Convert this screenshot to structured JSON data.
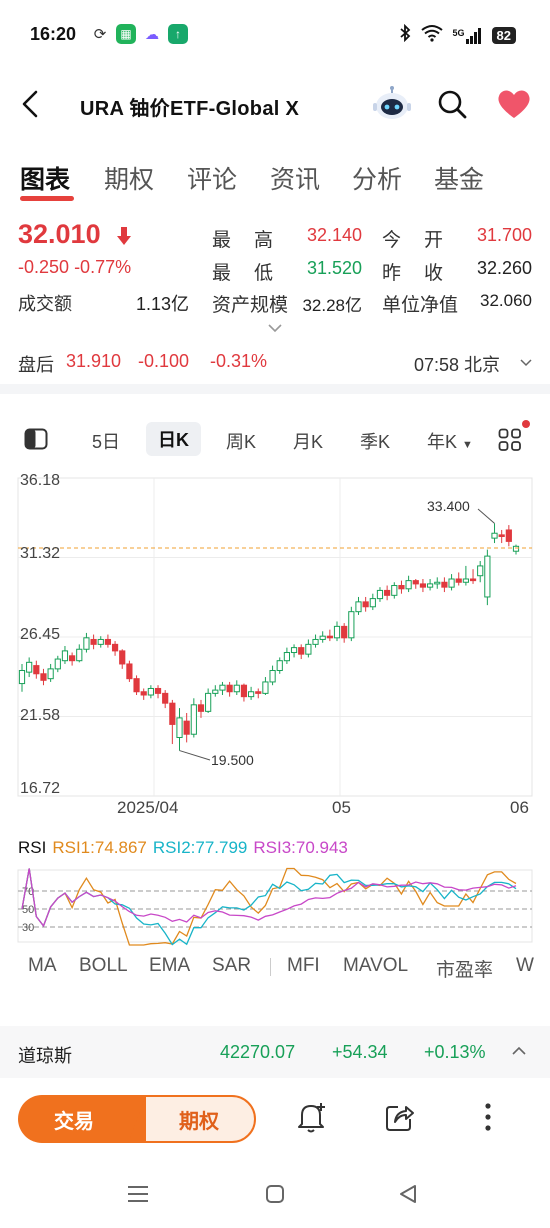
{
  "status": {
    "time": "16:20",
    "signal": "5G",
    "battery": "82"
  },
  "header": {
    "title": "URA  铀价ETF-Global X"
  },
  "tabs": [
    "图表",
    "期权",
    "评论",
    "资讯",
    "分析",
    "基金"
  ],
  "quote": {
    "price": "32.010",
    "change": "-0.250",
    "change_pct": "-0.77%",
    "volume_label": "成交额",
    "volume": "1.13亿",
    "high_label": "最　高",
    "high": "32.140",
    "low_label": "最　低",
    "low": "31.520",
    "aum_label": "资产规模",
    "aum": "32.28亿",
    "open_label": "今　开",
    "open": "31.700",
    "prev_close_label": "昨　收",
    "prev_close": "32.260",
    "nav_label": "单位净值",
    "nav": "32.060"
  },
  "after_hours": {
    "label": "盘后",
    "price": "31.910",
    "change": "-0.100",
    "change_pct": "-0.31%",
    "time": "07:58 北京"
  },
  "periods": [
    "5日",
    "日K",
    "周K",
    "月K",
    "季K",
    "年K"
  ],
  "colors": {
    "up": "#e0393e",
    "down": "#18a058",
    "accent": "#f0711e",
    "rsi1": "#e08a1e",
    "rsi2": "#18b4c8",
    "rsi3": "#c848c8"
  },
  "chart_data": {
    "type": "candlestick",
    "y_ticks": [
      "36.18",
      "31.32",
      "26.45",
      "21.58",
      "16.72"
    ],
    "ylim": [
      16.72,
      36.18
    ],
    "x_ticks": [
      "2025/04",
      "05",
      "06"
    ],
    "high_annotation": "33.400",
    "low_annotation": "19.500",
    "current_price_line": 31.9,
    "candles": [
      [
        23.6,
        24.4,
        24.8,
        23.1
      ],
      [
        24.3,
        24.9,
        25.2,
        24.0
      ],
      [
        24.7,
        24.2,
        25.0,
        23.9
      ],
      [
        24.2,
        23.8,
        24.5,
        23.5
      ],
      [
        23.9,
        24.5,
        24.8,
        23.7
      ],
      [
        24.5,
        25.1,
        25.3,
        24.3
      ],
      [
        25.0,
        25.6,
        25.9,
        24.8
      ],
      [
        25.3,
        25.0,
        25.5,
        24.7
      ],
      [
        25.0,
        25.7,
        26.0,
        24.9
      ],
      [
        25.7,
        26.4,
        26.7,
        25.5
      ],
      [
        26.3,
        26.0,
        26.6,
        25.7
      ],
      [
        26.0,
        26.3,
        26.5,
        25.8
      ],
      [
        26.3,
        26.0,
        26.6,
        25.8
      ],
      [
        26.0,
        25.6,
        26.2,
        25.3
      ],
      [
        25.6,
        24.8,
        25.7,
        24.5
      ],
      [
        24.8,
        23.9,
        25.0,
        23.7
      ],
      [
        23.9,
        23.1,
        24.1,
        22.9
      ],
      [
        23.1,
        22.9,
        23.3,
        22.6
      ],
      [
        22.9,
        23.3,
        23.5,
        22.7
      ],
      [
        23.3,
        23.0,
        23.5,
        22.7
      ],
      [
        23.0,
        22.4,
        23.2,
        22.1
      ],
      [
        22.4,
        21.1,
        22.6,
        19.9
      ],
      [
        20.3,
        21.5,
        22.1,
        19.5
      ],
      [
        21.3,
        20.5,
        21.8,
        20.0
      ],
      [
        20.5,
        22.3,
        22.7,
        20.3
      ],
      [
        22.3,
        21.9,
        22.6,
        21.5
      ],
      [
        21.9,
        23.0,
        23.3,
        21.8
      ],
      [
        23.0,
        23.2,
        23.5,
        22.8
      ],
      [
        23.2,
        23.5,
        23.7,
        22.9
      ],
      [
        23.5,
        23.1,
        23.7,
        22.8
      ],
      [
        23.1,
        23.5,
        23.8,
        22.9
      ],
      [
        23.5,
        22.8,
        23.6,
        22.5
      ],
      [
        22.8,
        23.1,
        23.4,
        22.6
      ],
      [
        23.1,
        23.0,
        23.3,
        22.7
      ],
      [
        23.0,
        23.7,
        24.0,
        22.9
      ],
      [
        23.7,
        24.4,
        24.7,
        23.5
      ],
      [
        24.4,
        25.0,
        25.2,
        24.2
      ],
      [
        25.0,
        25.5,
        25.8,
        24.8
      ],
      [
        25.5,
        25.8,
        26.0,
        25.2
      ],
      [
        25.8,
        25.4,
        26.0,
        25.1
      ],
      [
        25.4,
        26.0,
        26.3,
        25.2
      ],
      [
        26.0,
        26.3,
        26.6,
        25.8
      ],
      [
        26.3,
        26.5,
        26.8,
        26.1
      ],
      [
        26.5,
        26.4,
        26.9,
        26.2
      ],
      [
        26.4,
        27.1,
        27.4,
        26.2
      ],
      [
        27.1,
        26.4,
        27.3,
        26.1
      ],
      [
        26.4,
        28.0,
        28.3,
        26.2
      ],
      [
        28.0,
        28.6,
        28.9,
        27.8
      ],
      [
        28.6,
        28.3,
        28.9,
        28.0
      ],
      [
        28.3,
        28.8,
        29.1,
        28.1
      ],
      [
        28.8,
        29.3,
        29.5,
        28.6
      ],
      [
        29.3,
        29.0,
        29.6,
        28.7
      ],
      [
        29.0,
        29.6,
        29.8,
        28.8
      ],
      [
        29.6,
        29.4,
        29.9,
        29.1
      ],
      [
        29.4,
        29.9,
        30.2,
        29.2
      ],
      [
        29.9,
        29.7,
        30.0,
        29.4
      ],
      [
        29.7,
        29.5,
        30.0,
        29.2
      ],
      [
        29.5,
        29.7,
        30.0,
        29.3
      ],
      [
        29.7,
        29.8,
        30.1,
        29.4
      ],
      [
        29.8,
        29.5,
        30.1,
        29.2
      ],
      [
        29.5,
        30.0,
        30.3,
        29.3
      ],
      [
        30.0,
        29.8,
        30.4,
        29.6
      ],
      [
        29.8,
        30.0,
        30.8,
        29.6
      ],
      [
        30.0,
        29.9,
        30.6,
        29.7
      ],
      [
        30.2,
        30.8,
        31.1,
        29.8
      ],
      [
        28.9,
        31.4,
        31.8,
        28.4
      ],
      [
        32.5,
        32.8,
        33.4,
        32.2
      ],
      [
        32.7,
        32.6,
        33.0,
        32.2
      ],
      [
        33.0,
        32.3,
        33.3,
        32.0
      ],
      [
        31.7,
        32.0,
        32.1,
        31.5
      ]
    ]
  },
  "rsi": {
    "label": "RSI",
    "rsi1": "RSI1:74.867",
    "rsi2": "RSI2:77.799",
    "rsi3": "RSI3:70.943",
    "levels": [
      70,
      50,
      30
    ]
  },
  "indicators": [
    "MA",
    "BOLL",
    "EMA",
    "SAR",
    "MFI",
    "MAVOL",
    "市盈率",
    "W"
  ],
  "ticker": {
    "name": "道琼斯",
    "value": "42270.07",
    "change": "+54.34",
    "change_pct": "+0.13%"
  },
  "bottom": {
    "trade_label": "交易",
    "options_label": "期权"
  }
}
